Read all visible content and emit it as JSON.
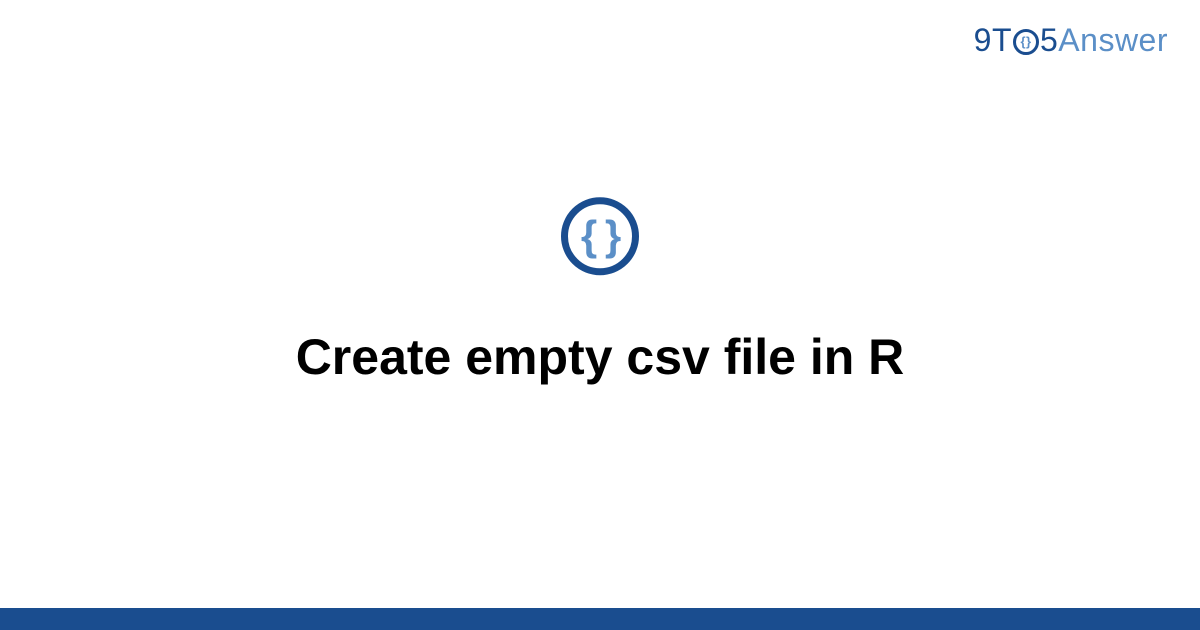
{
  "brand": {
    "part_nine": "9",
    "part_t": "T",
    "part_five": "5",
    "part_answer": "Answer"
  },
  "icon": {
    "braces": "{ }",
    "name": "code-braces-icon"
  },
  "title": "Create empty csv file in R",
  "colors": {
    "primary": "#1a4d8f",
    "secondary": "#5b8fc7"
  }
}
